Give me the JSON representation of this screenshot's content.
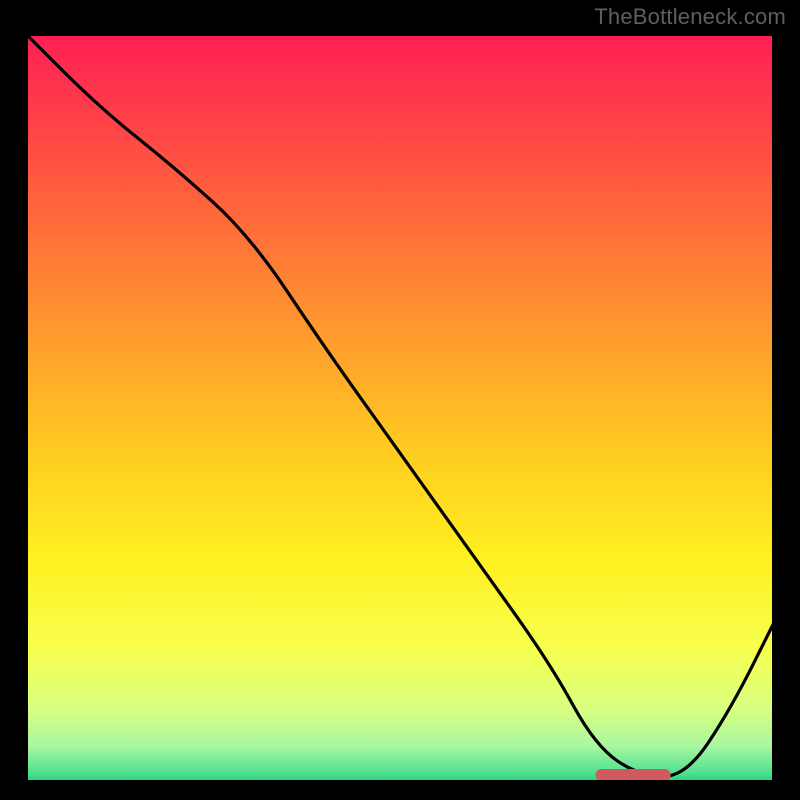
{
  "watermark": "TheBottleneck.com",
  "chart_data": {
    "type": "line",
    "title": "",
    "xlabel": "",
    "ylabel": "",
    "xlim": [
      0,
      100
    ],
    "ylim": [
      0,
      100
    ],
    "curve": {
      "name": "bottleneck-curve",
      "x": [
        0,
        10,
        20,
        30,
        40,
        50,
        60,
        70,
        76,
        82,
        88,
        94,
        100
      ],
      "y": [
        100,
        90,
        82,
        73,
        58,
        44,
        30,
        16,
        5,
        1,
        1,
        10,
        22
      ]
    },
    "optimal_marker": {
      "x_start": 76,
      "x_end": 86,
      "y": 1.2,
      "color": "#cf5a5f"
    },
    "gradient_stops": [
      {
        "offset": 0.0,
        "color": "#ff1e55"
      },
      {
        "offset": 0.1,
        "color": "#ff3b4a"
      },
      {
        "offset": 0.25,
        "color": "#ff6a3a"
      },
      {
        "offset": 0.4,
        "color": "#ff9a2e"
      },
      {
        "offset": 0.55,
        "color": "#ffc922"
      },
      {
        "offset": 0.7,
        "color": "#fff020"
      },
      {
        "offset": 0.82,
        "color": "#f7ff4e"
      },
      {
        "offset": 0.9,
        "color": "#d9ff80"
      },
      {
        "offset": 0.95,
        "color": "#a8f7a0"
      },
      {
        "offset": 0.985,
        "color": "#4fe191"
      },
      {
        "offset": 1.0,
        "color": "#1fc97a"
      }
    ],
    "grid": false,
    "legend": false
  }
}
